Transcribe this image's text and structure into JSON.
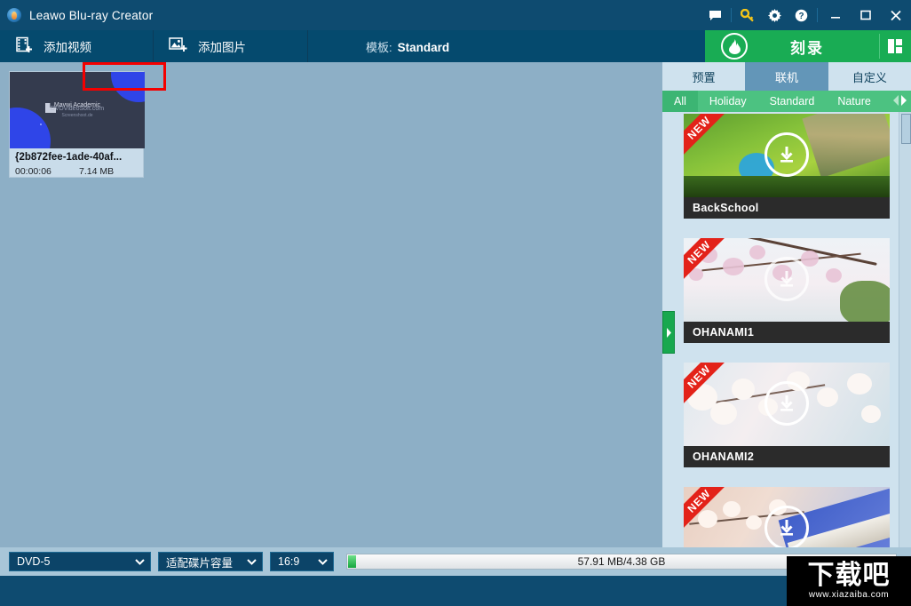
{
  "window": {
    "title": "Leawo Blu-ray Creator",
    "app_icon": "leawo-app-icon",
    "controls": {
      "feedback": "chat-bubble-icon",
      "register": "key-icon",
      "settings": "gear-icon",
      "help": "help-icon",
      "minimize": "minimize-icon",
      "maximize": "maximize-icon",
      "close": "close-icon"
    }
  },
  "toolbar": {
    "add_video": "添加视频",
    "add_image": "添加图片",
    "template_label": "模板:",
    "template_value": "Standard",
    "burn_label": "刻录",
    "burn_icon": "flame-icon",
    "layout_icon": "layout-grid-icon"
  },
  "media": {
    "items": [
      {
        "name": "{2b872fee-1ade-40af...",
        "duration": "00:00:06",
        "size": "7.14 MB",
        "thumb_text_1": "Mavwi Academic",
        "thumb_text_2": "DVDVideoSoft.com",
        "thumb_text_3": "Screenshoot.de"
      }
    ]
  },
  "right_panel": {
    "tabs": [
      {
        "label": "预置",
        "active": false
      },
      {
        "label": "联机",
        "active": true
      },
      {
        "label": "自定义",
        "active": false
      }
    ],
    "highlight_color": "#f40000",
    "categories": [
      {
        "label": "All",
        "active": true
      },
      {
        "label": "Holiday",
        "active": false
      },
      {
        "label": "Standard",
        "active": false
      },
      {
        "label": "Nature",
        "active": false
      }
    ],
    "category_nav": {
      "prev": "chevron-left-icon",
      "next": "chevron-right-icon"
    },
    "templates": [
      {
        "name": "BackSchool",
        "badge": "NEW",
        "download_icon": "download-icon",
        "art": "art-back"
      },
      {
        "name": "OHANAMI1",
        "badge": "NEW",
        "download_icon": "download-icon",
        "art": "art-oh1"
      },
      {
        "name": "OHANAMI2",
        "badge": "NEW",
        "download_icon": "download-icon",
        "art": "art-oh2"
      },
      {
        "name": "",
        "badge": "NEW",
        "download_icon": "download-icon",
        "art": "art-note"
      }
    ],
    "collapse_icon": "chevron-right-icon"
  },
  "bottom": {
    "disc_type": "DVD-5",
    "fit_mode": "适配碟片容量",
    "aspect_ratio": "16:9",
    "capacity_text": "57.91 MB/4.38 GB",
    "capacity_fill_color": "#16a63f"
  },
  "watermark": {
    "main": "下载吧",
    "sub": "www.xiazaiba.com"
  },
  "colors": {
    "titlebar": "#0e4b70",
    "toolbar": "#054a6e",
    "accent_green": "#19ac54",
    "main_bg": "#8dafc6",
    "panel_bg": "#cfe2ee"
  }
}
